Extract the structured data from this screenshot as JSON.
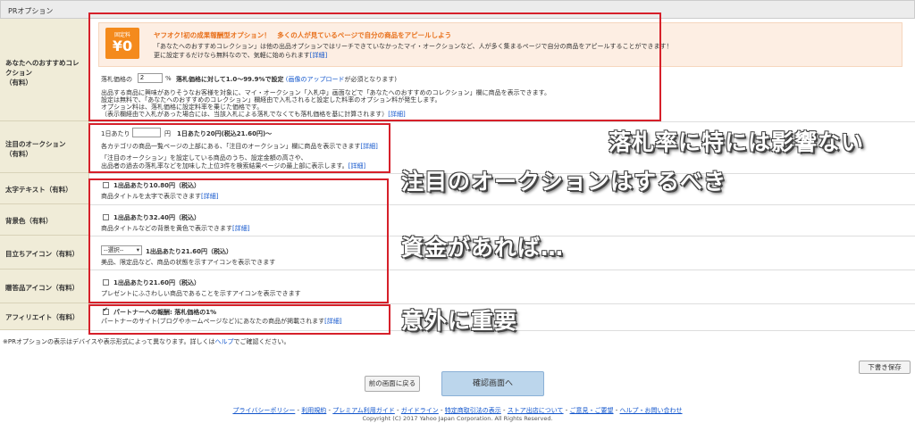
{
  "header": {
    "title": "PRオプション"
  },
  "labels": {
    "recommend": [
      "あなたへのおすすめコレクション",
      "（有料）"
    ],
    "attention": [
      "注目のオークション",
      "（有料）"
    ],
    "bold": "太字テキスト（有料）",
    "bgcolor": "背景色（有料）",
    "icon": "目立ちアイコン（有料）",
    "gift": "贈答品アイコン（有料）",
    "affiliate": "アフィリエイト（有料）"
  },
  "recommend": {
    "badge_small": "固定料",
    "badge_big": "¥0",
    "headline": "ヤフオク!初の成果報酬型オプション！　多くの人が見ているページで自分の商品をアピールしよう",
    "desc1": "「あなたへのおすすめコレクション」は他の出品オプションではリーチできていなかったマイ・オークションなど、人が多く集まるページで自分の商品をアピールすることができます！",
    "desc2_prefix": "更に設定するだけなら無料なので、気軽に始められます",
    "detail_link": "[詳細]",
    "rate_label": "落札価格の",
    "rate_value": "2",
    "rate_suffix": "%",
    "rate_note": "落札価格に対して1.0〜99.9%で設定",
    "image_upload_note_link": "(画像のアップロード",
    "image_upload_note_rest": "が必須となります)",
    "body1": "出品する商品に興味がありそうなお客様を対象に、マイ・オークション「入札中」画面などで「あなたへのおすすめのコレクション」欄に商品を表示できます。",
    "body2": "設定は無料で、「あなたへのおすすめのコレクション」欄経由で入札されると設定した料率のオプション料が発生します。",
    "body3": "オプション料は、落札価格に設定料率を乗じた価格です。",
    "body4": "（表示欄経由で入札があった場合には、当該入札による落札でなくても落札価格を基に計算されます）"
  },
  "attention": {
    "prefix": "1日あたり",
    "value": "",
    "unit": "円",
    "price_note": "1日あたり20円(税込21.60円)〜",
    "desc1": "各カテゴリの商品一覧ページの上部にある、「注目のオークション」欄に商品を表示できます",
    "desc2": "「注目のオークション」を設定している商品のうち、設定金額の高さや、",
    "desc3": "出品者の過去の落札率などを加味した上位3件を検索結果ページの最上部に表示します。"
  },
  "bold": {
    "price": "1出品あたり10.80円（税込）",
    "desc": "商品タイトルを太字で表示できます"
  },
  "bgcolor": {
    "price": "1出品あたり32.40円（税込）",
    "desc": "商品タイトルなどの背景を黄色で表示できます"
  },
  "icon": {
    "select": "--選択--",
    "price": "1出品あたり21.60円（税込）",
    "desc": "美品、限定品など、商品の状態を示すアイコンを表示できます"
  },
  "gift": {
    "price": "1出品あたり21.60円（税込）",
    "desc": "プレゼントにふさわしい商品であることを示すアイコンを表示できます"
  },
  "affiliate": {
    "title": "パートナーへの報酬: 落札価格の1%",
    "desc": "パートナーのサイト(ブログやホームページなど)にあなたの商品が掲載されます"
  },
  "note": {
    "prefix": "※PRオプションの表示はデバイスや表示形式によって異なります。詳しくは",
    "help_link": "ヘルプ",
    "suffix": "でご確認ください。"
  },
  "captions": {
    "c1": "落札率に特には影響ない",
    "c2": "注目のオークションはするべき",
    "c3": "資金があれば…",
    "c4": "意外に重要"
  },
  "buttons": {
    "back": "前の画面に戻る",
    "confirm": "確認画面へ",
    "draft": "下書き保存"
  },
  "footer": {
    "links": [
      "プライバシーポリシー",
      "利用規約",
      "プレミアム利用ガイド",
      "ガイドライン",
      "特定商取引法の表示",
      "ストア出店について",
      "ご意見・ご要望",
      "ヘルプ・お問い合わせ"
    ],
    "copyright": "Copyright (C) 2017 Yahoo Japan Corporation. All Rights Reserved."
  },
  "colors": {
    "annotation_red": "#d6202a",
    "label_bg": "#f0ecd8",
    "accent_orange": "#f48a1c",
    "link_blue": "#1155cc"
  }
}
